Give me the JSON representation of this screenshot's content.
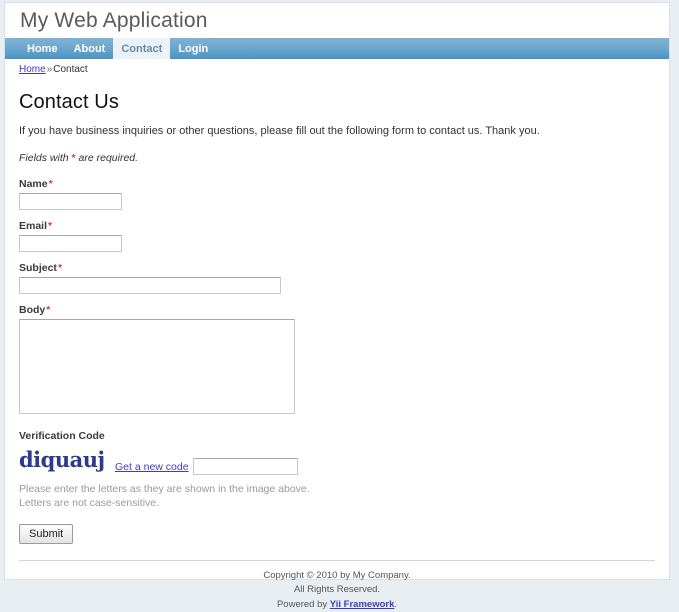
{
  "site": {
    "title": "My Web Application"
  },
  "mainmenu": {
    "items": [
      {
        "label": "Home",
        "active": false
      },
      {
        "label": "About",
        "active": false
      },
      {
        "label": "Contact",
        "active": true
      },
      {
        "label": "Login",
        "active": false
      }
    ]
  },
  "breadcrumbs": {
    "home_label": "Home",
    "separator": "»",
    "current": "Contact"
  },
  "page": {
    "heading": "Contact Us",
    "intro": "If you have business inquiries or other questions, please fill out the following form to contact us. Thank you.",
    "required_note_before": "Fields with ",
    "required_star": "*",
    "required_note_after": " are required."
  },
  "form": {
    "name": {
      "label": "Name",
      "star": "*",
      "value": "",
      "placeholder": ""
    },
    "email": {
      "label": "Email",
      "star": "*",
      "value": "",
      "placeholder": ""
    },
    "subject": {
      "label": "Subject",
      "star": "*",
      "value": "",
      "placeholder": ""
    },
    "body": {
      "label": "Body",
      "star": "*",
      "value": "",
      "placeholder": ""
    },
    "verification": {
      "label": "Verification Code",
      "captcha_text": "diquauj",
      "captcha_color": "#2b3a8f",
      "refresh_label": "Get a new code",
      "value": "",
      "placeholder": "",
      "hint_line1": "Please enter the letters as they are shown in the image above.",
      "hint_line2": "Letters are not case-sensitive."
    },
    "submit_label": "Submit"
  },
  "footer": {
    "line1": "Copyright © 2010 by My Company.",
    "line2": "All Rights Reserved.",
    "powered_prefix": "Powered by ",
    "powered_link": "Yii Framework",
    "powered_suffix": "."
  },
  "colors": {
    "nav_top": "#7fb2d4",
    "nav_bottom": "#4a93c3",
    "link": "#3b3bc4",
    "required": "#d24141",
    "page_bg": "#e9eef3"
  }
}
